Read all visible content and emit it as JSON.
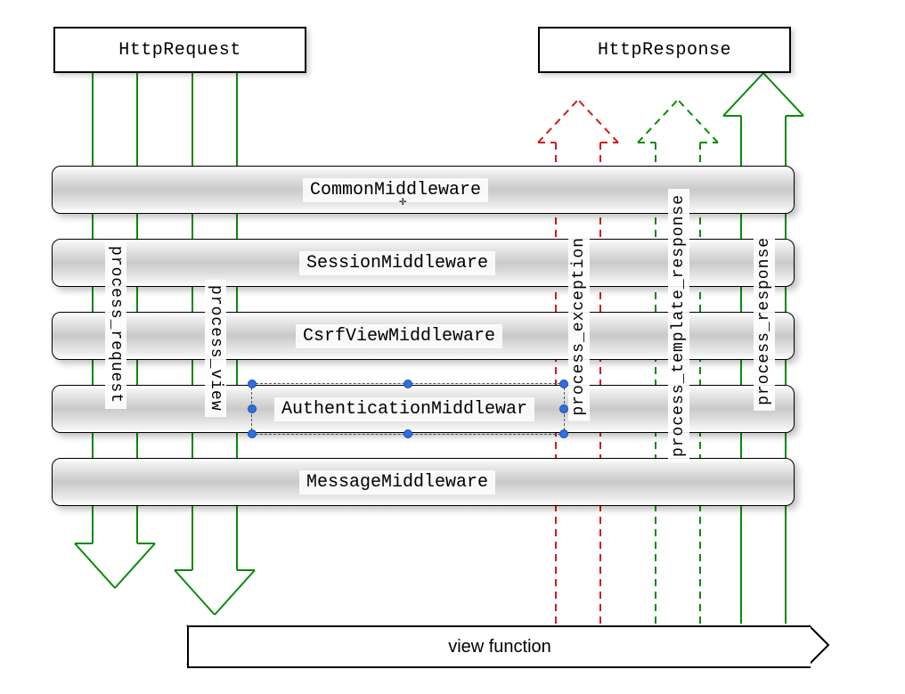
{
  "header": {
    "request_label": "HttpRequest",
    "response_label": "HttpResponse"
  },
  "middlewares": [
    {
      "label": "CommonMiddleware"
    },
    {
      "label": "SessionMiddleware"
    },
    {
      "label": "CsrfViewMiddleware"
    },
    {
      "label": "AuthenticationMiddlewar"
    },
    {
      "label": "MessageMiddleware"
    }
  ],
  "arrow_labels": {
    "process_request": "process_request",
    "process_view": "process_view",
    "process_exception": "process_exception",
    "process_template_response": "process_template_response",
    "process_response": "process_response"
  },
  "footer": {
    "view_function": "view function"
  },
  "colors": {
    "green": "#0a8a0a",
    "red": "#d11a1a",
    "black": "#000000"
  }
}
